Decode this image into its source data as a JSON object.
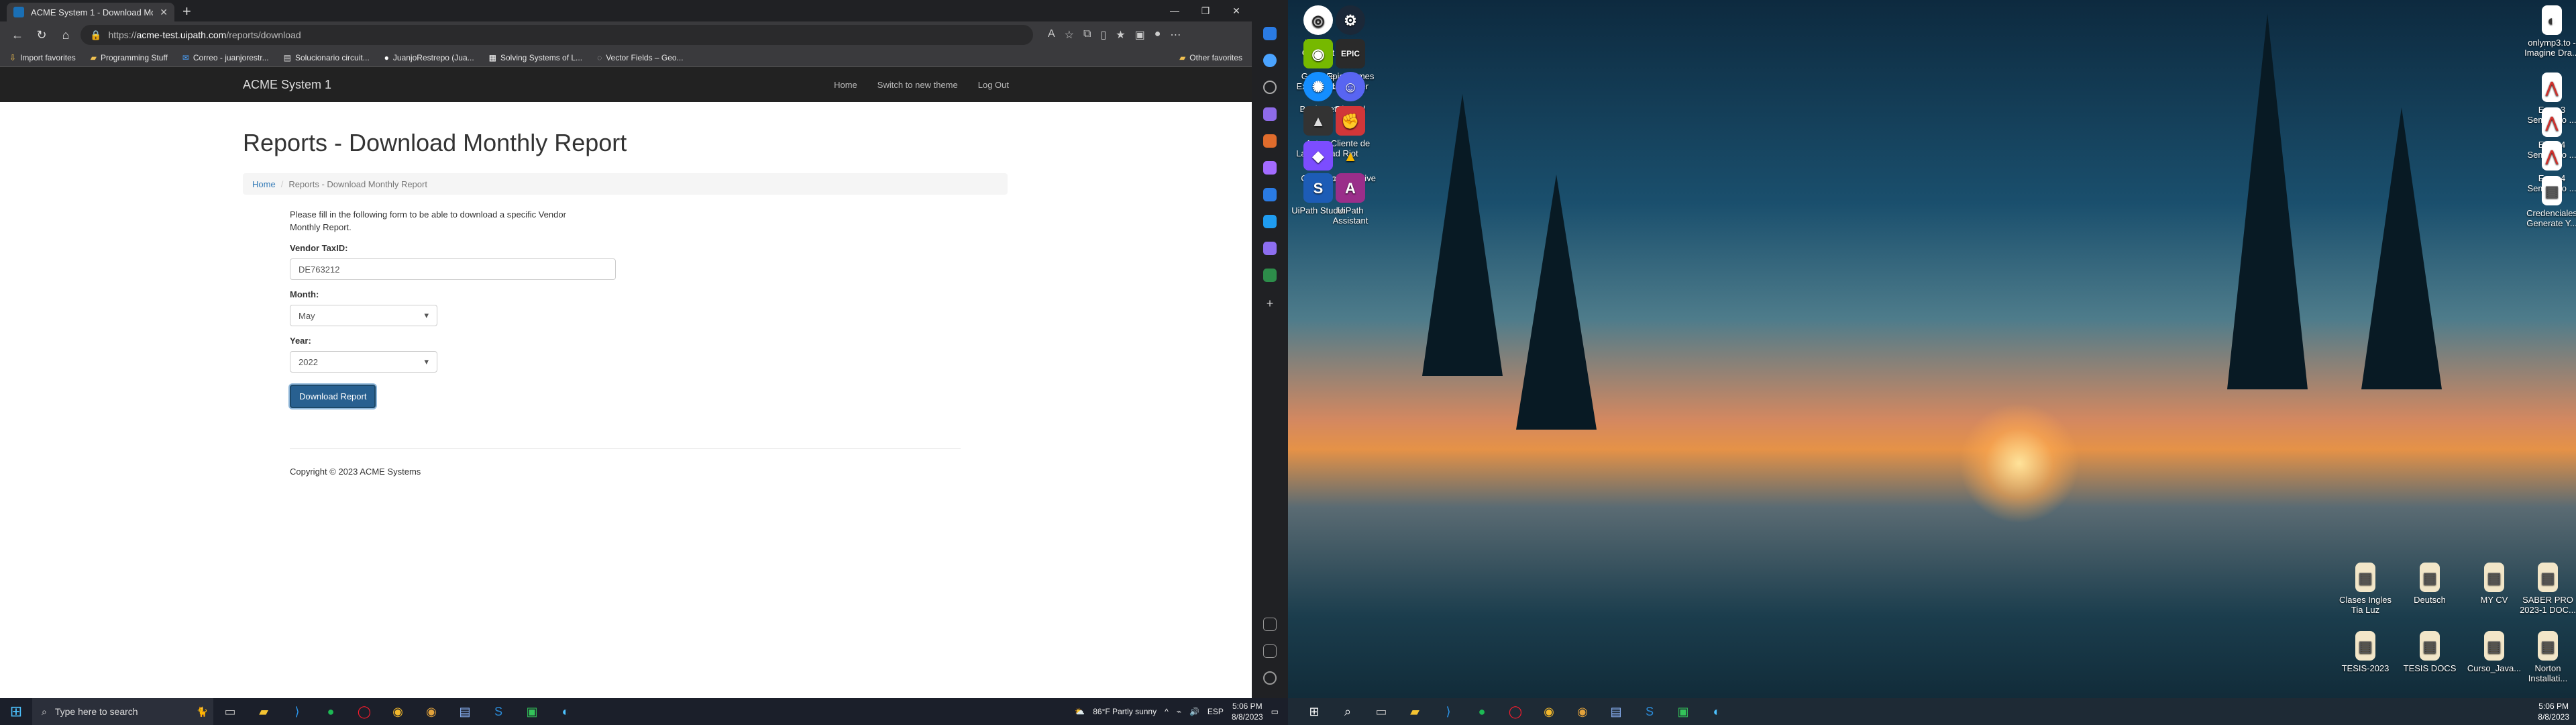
{
  "browser": {
    "tab_title": "ACME System 1 - Download Mo...",
    "url_prefix": "https://",
    "url_domain": "acme-test.uipath.com",
    "url_path": "/reports/download",
    "favorites": [
      {
        "label": "Import favorites",
        "icon": "import-icon"
      },
      {
        "label": "Programming Stuff",
        "icon": "folder-icon"
      },
      {
        "label": "Correo - juanjorestr...",
        "icon": "mail-icon"
      },
      {
        "label": "Solucionario circuit...",
        "icon": "file-icon"
      },
      {
        "label": "JuanjoRestrepo (Jua...",
        "icon": "github-icon"
      },
      {
        "label": "Solving Systems of L...",
        "icon": "grid-icon"
      },
      {
        "label": "Vector Fields – Geo...",
        "icon": "globe-icon"
      }
    ],
    "other_favorites": "Other favorites"
  },
  "site": {
    "brand": "ACME System 1",
    "nav": [
      "Home",
      "Switch to new theme",
      "Log Out"
    ],
    "heading": "Reports - Download Monthly Report",
    "breadcrumb_home": "Home",
    "breadcrumb_current": "Reports - Download Monthly Report",
    "intro": "Please fill in the following form to be able to download a specific Vendor Monthly Report.",
    "taxid_label": "Vendor TaxID:",
    "taxid_value": "DE763212",
    "month_label": "Month:",
    "month_value": "May",
    "year_label": "Year:",
    "year_value": "2022",
    "download_button": "Download Report",
    "copyright": "Copyright © 2023 ACME Systems"
  },
  "taskbar1": {
    "search_placeholder": "Type here to search",
    "weather": "86°F  Partly sunny",
    "lang": "ESP",
    "time": "5:06 PM",
    "date": "8/8/2023"
  },
  "taskbar2": {
    "time": "5:06 PM",
    "date": "8/8/2023"
  },
  "desktop": {
    "icons": [
      {
        "label": "Ubisoft Connect",
        "icon": "ubisoft-icon"
      },
      {
        "label": "Steam",
        "icon": "steam-icon"
      },
      {
        "label": "GeForce Experience",
        "icon": "nvidia-icon"
      },
      {
        "label": "Epic Games Launcher",
        "icon": "epic-icon"
      },
      {
        "label": "Battle.net",
        "icon": "battlenet-icon"
      },
      {
        "label": "Discord",
        "icon": "discord-icon"
      },
      {
        "label": "Actron LaunchPad",
        "icon": "actron-icon"
      },
      {
        "label": "Cliente de Riot",
        "icon": "riot-icon"
      },
      {
        "label": "Obsidian",
        "icon": "obsidian-icon"
      },
      {
        "label": "Google Drive",
        "icon": "drive-icon"
      },
      {
        "label": "UiPath Studio",
        "icon": "uipath-studio-icon"
      },
      {
        "label": "UiPath Assistant",
        "icon": "uipath-assistant-icon"
      },
      {
        "label": "onlymp3.to - Imagine Dra...",
        "icon": "file-icon"
      },
      {
        "label": "Expo 3 Seminario ...",
        "icon": "pdf-icon"
      },
      {
        "label": "Expo 4 Seminario ...",
        "icon": "pdf-icon"
      },
      {
        "label": "Expo 4 Seminario ...",
        "icon": "pdf-icon"
      },
      {
        "label": "Credenciales Generate Y...",
        "icon": "file-icon"
      },
      {
        "label": "Clases Ingles Tia Luz",
        "icon": "doc-icon"
      },
      {
        "label": "Deutsch",
        "icon": "doc-icon"
      },
      {
        "label": "MY CV",
        "icon": "doc-icon"
      },
      {
        "label": "SABER PRO 2023-1 DOC...",
        "icon": "doc-icon"
      },
      {
        "label": "TESIS-2023",
        "icon": "doc-icon"
      },
      {
        "label": "TESIS DOCS",
        "icon": "doc-icon"
      },
      {
        "label": "Curso_Java...",
        "icon": "doc-icon"
      },
      {
        "label": "Norton Installati...",
        "icon": "doc-icon"
      }
    ]
  }
}
